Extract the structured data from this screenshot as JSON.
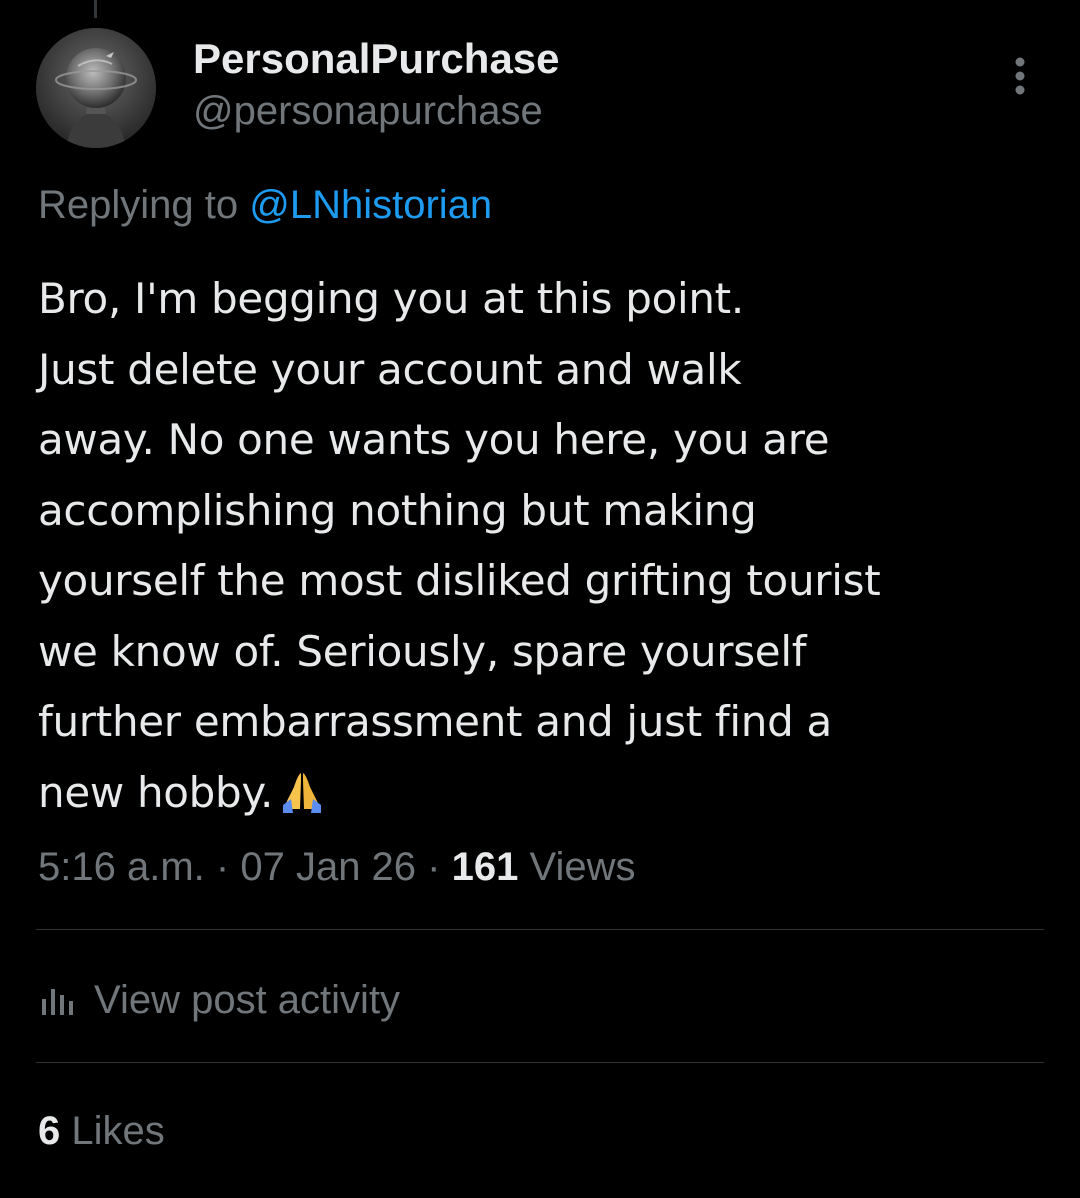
{
  "author": {
    "display_name": "PersonalPurchase",
    "handle": "@personapurchase"
  },
  "reply": {
    "prefix": "Replying to",
    "mention": "@LNhistorian"
  },
  "tweet": {
    "lines": [
      "Bro, I'm begging you at this point.",
      "Just delete your account and walk",
      "away. No one wants you here, you are",
      "accomplishing nothing but making",
      "yourself the most disliked grifting tourist",
      "we know of. Seriously, spare yourself",
      "further embarrassment and just find a",
      "new hobby."
    ],
    "emoji": "🙏"
  },
  "meta": {
    "time": "5:16 a.m.",
    "separator": "·",
    "date": "07 Jan 26",
    "views_count": "161",
    "views_label": "Views"
  },
  "activity": {
    "label": "View post activity"
  },
  "likes": {
    "count": "6",
    "label": "Likes"
  },
  "colors": {
    "background": "#000000",
    "text_primary": "#e7e9ea",
    "text_secondary": "#71767b",
    "link": "#1d9bf0",
    "divider": "#2f3336"
  },
  "icons": {
    "more": "more-vertical-icon",
    "activity": "bar-chart-icon"
  }
}
